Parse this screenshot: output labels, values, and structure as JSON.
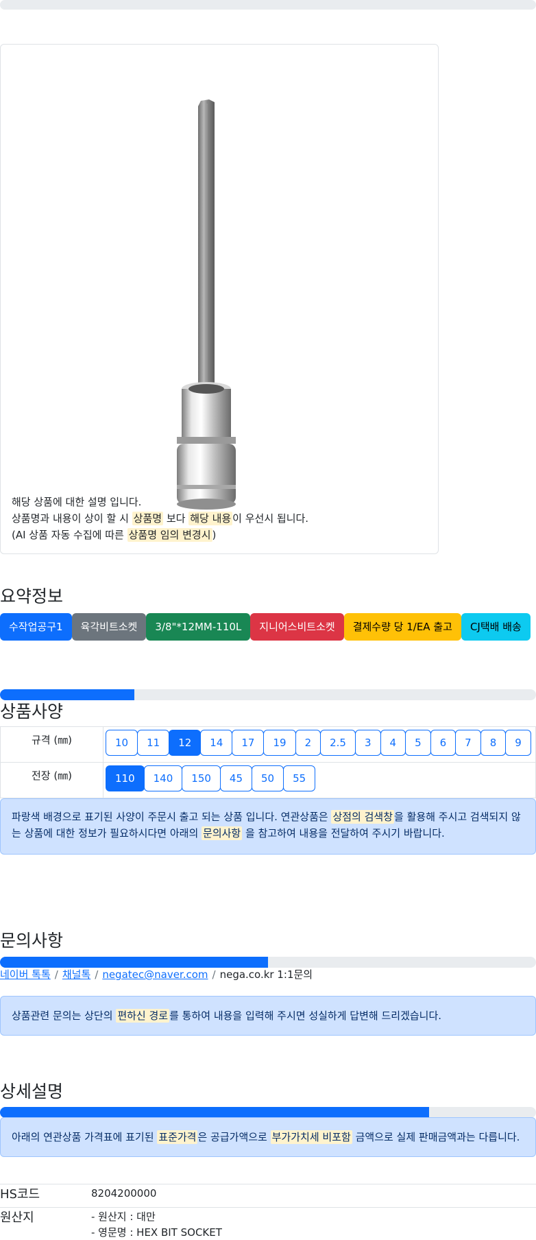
{
  "product": {
    "description_line1": "해당 상품에 대한 설명 입니다.",
    "desc2_a": "상품명과 내용이 상이 할 시 ",
    "desc2_hl1": "상품명",
    "desc2_b": " 보다 ",
    "desc2_hl2": "해당 내용",
    "desc2_c": "이 우선시 됩니다.",
    "desc3_a": "(AI 상품 자동 수집에 따른 ",
    "desc3_hl": "상품명 임의 변경시",
    "desc3_b": ")"
  },
  "summary": {
    "title": "요약정보",
    "badges": [
      {
        "label": "수작업공구1",
        "color": "#0d6efd"
      },
      {
        "label": "육각비트소켓",
        "color": "#6c757d"
      },
      {
        "label": "3/8\"*12MM-110L",
        "color": "#198754"
      },
      {
        "label": "지니어스비트소켓",
        "color": "#dc3545"
      },
      {
        "label": "결제수량 당 1/EA 출고",
        "color": "#ffc107"
      },
      {
        "label": "CJ택배 배송",
        "color": "#0dcaf0"
      }
    ]
  },
  "progress": {
    "spec": 0.25,
    "inquiry": 0.5,
    "detail": 0.8
  },
  "specs": {
    "title": "상품사양",
    "rows": [
      {
        "label": "규격 (㎜)",
        "options": [
          "10",
          "11",
          "12",
          "14",
          "17",
          "19",
          "2",
          "2.5",
          "3",
          "4",
          "5",
          "6",
          "7",
          "8",
          "9"
        ],
        "selected": "12"
      },
      {
        "label": "전장 (㎜)",
        "options": [
          "110",
          "140",
          "150",
          "45",
          "50",
          "55"
        ],
        "selected": "110"
      }
    ],
    "notice_a": "파랑색 배경으로 표기된 사양이 주문시 출고 되는 상품 입니다. 연관상품은 ",
    "notice_hl1": "상점의 검색창",
    "notice_b": "을 활용해 주시고 검색되지 않는 상품에 대한 정보가 필요하시다면 아래의 ",
    "notice_hl2": "문의사항",
    "notice_c": " 을 참고하여 내용을 전달하여 주시기 바랍니다."
  },
  "inquiry": {
    "title": "문의사항",
    "links": [
      "네이버 톡톡",
      "채널톡",
      "negatec@naver.com"
    ],
    "plain": "nega.co.kr 1:1문의",
    "separator": "/",
    "notice_a": "상품관련 문의는 상단의 ",
    "notice_hl": "편하신 경로",
    "notice_b": "를 통하여 내용을 입력해 주시면 성실하게 답변해 드리겠습니다."
  },
  "detail": {
    "title": "상세설명",
    "notice_a": "아래의 연관상품 가격표에 표기된 ",
    "notice_hl1": "표준가격",
    "notice_b": "은 공급가액으로 ",
    "notice_hl2": "부가가치세 비포함",
    "notice_c": " 금액으로 실제 판매금액과는 다릅니다.",
    "hs_label": "HS코드",
    "hs_value": "8204200000",
    "origin_label": "원산지",
    "origin_line1": "- 원산지 : 대만",
    "origin_line2": "- 영문명 : HEX BIT SOCKET"
  }
}
